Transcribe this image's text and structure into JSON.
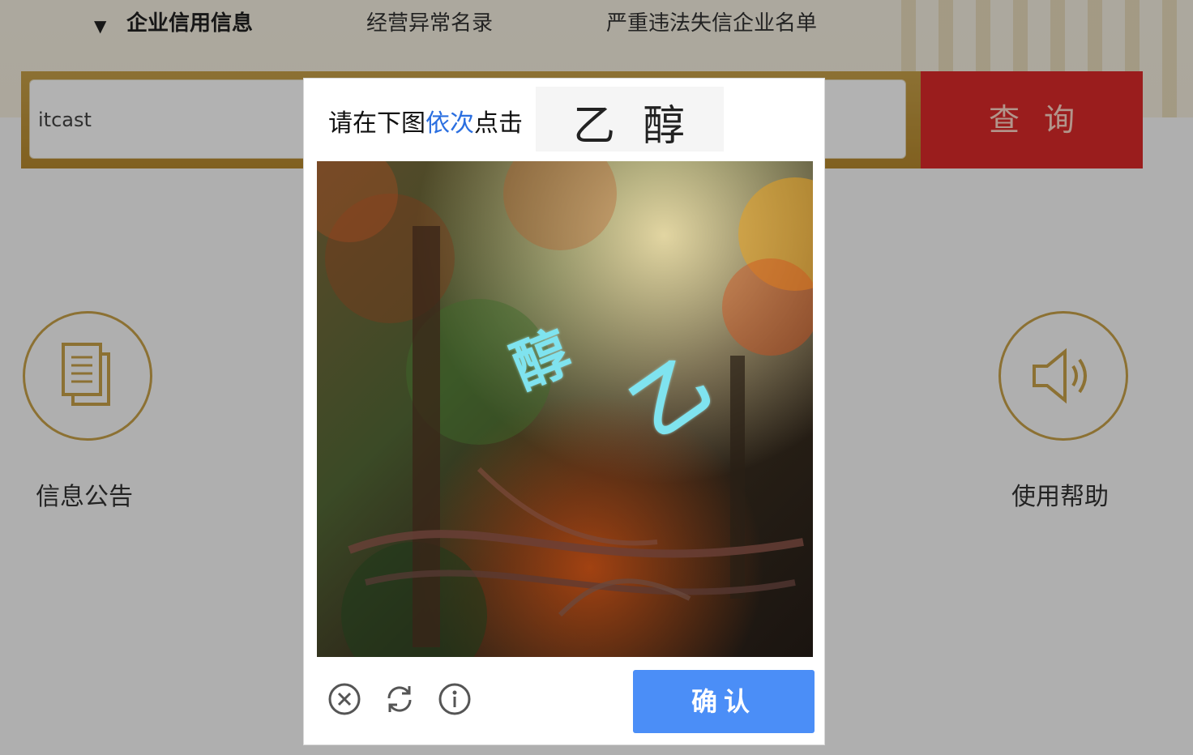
{
  "nav": {
    "items": [
      "企业信用信息",
      "经营异常名录",
      "严重违法失信企业名单"
    ]
  },
  "search": {
    "value": "itcast",
    "button_label": "查询"
  },
  "features": {
    "left_label": "信息公告",
    "right_label": "使用帮助",
    "left_icon": "document-icon",
    "right_icon": "speaker-icon"
  },
  "captcha": {
    "prompt_prefix": "请在下图",
    "prompt_highlight": "依次",
    "prompt_suffix": "点击",
    "targets": [
      "乙",
      "醇"
    ],
    "image_glyphs": [
      "醇",
      "乙"
    ],
    "confirm_label": "确认",
    "tools": [
      "close-icon",
      "refresh-icon",
      "info-icon"
    ]
  },
  "colors": {
    "accent_gold": "#c9a24a",
    "search_red": "#dd2a2a",
    "confirm_blue": "#4b8ef7",
    "prompt_highlight": "#2b6fe0",
    "glyph_cyan": "#7fe3ef"
  }
}
